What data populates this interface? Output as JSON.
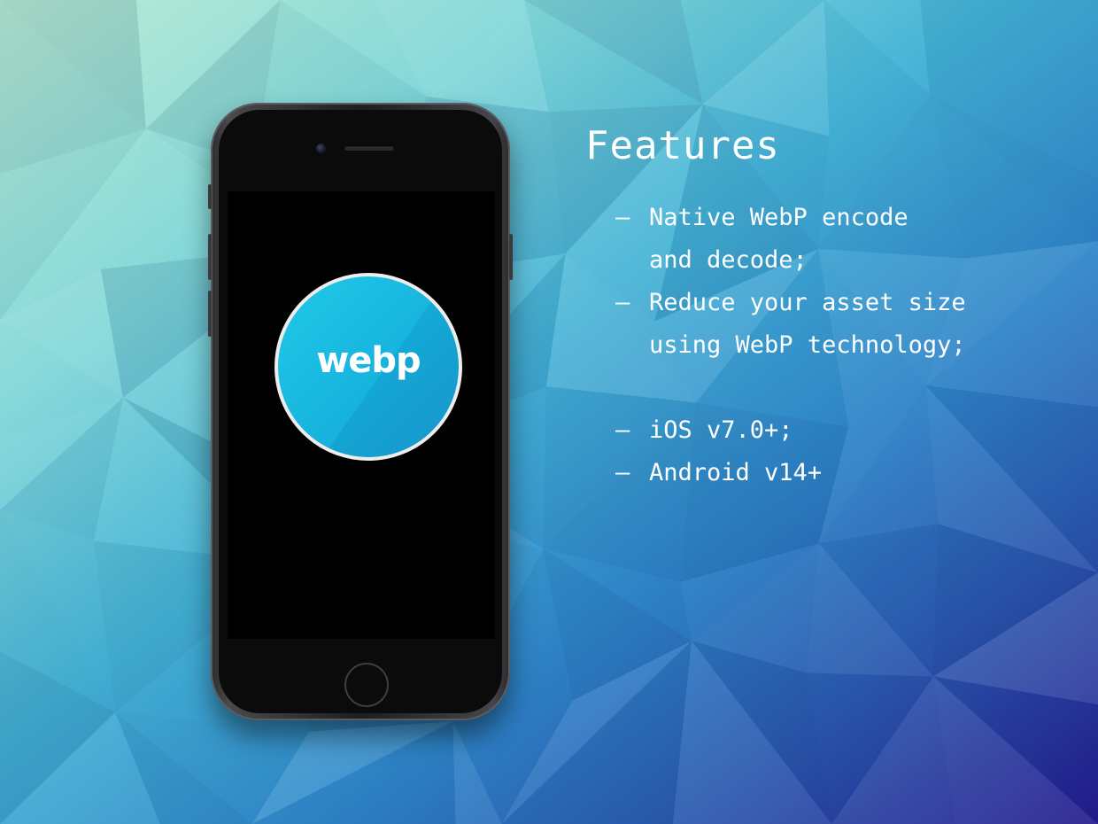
{
  "background": {
    "colors": [
      "#b9ecd2",
      "#7fd6d8",
      "#45b3d6",
      "#2f86c9",
      "#2b56ad",
      "#241a8c"
    ]
  },
  "phone": {
    "color": "#2a2a2c",
    "screen_color": "#000000",
    "app_logo": {
      "text": "webp",
      "circle_color": "#1cb8e0",
      "border_color": "#ededed"
    }
  },
  "features": {
    "title": "Features",
    "items": [
      {
        "bullet": "–",
        "text": "Native WebP encode\nand decode;"
      },
      {
        "bullet": "–",
        "text": "Reduce your asset size\nusing WebP technology;"
      },
      {
        "bullet": "–",
        "text": "iOS v7.0+;"
      },
      {
        "bullet": "–",
        "text": "Android v14+"
      }
    ]
  }
}
